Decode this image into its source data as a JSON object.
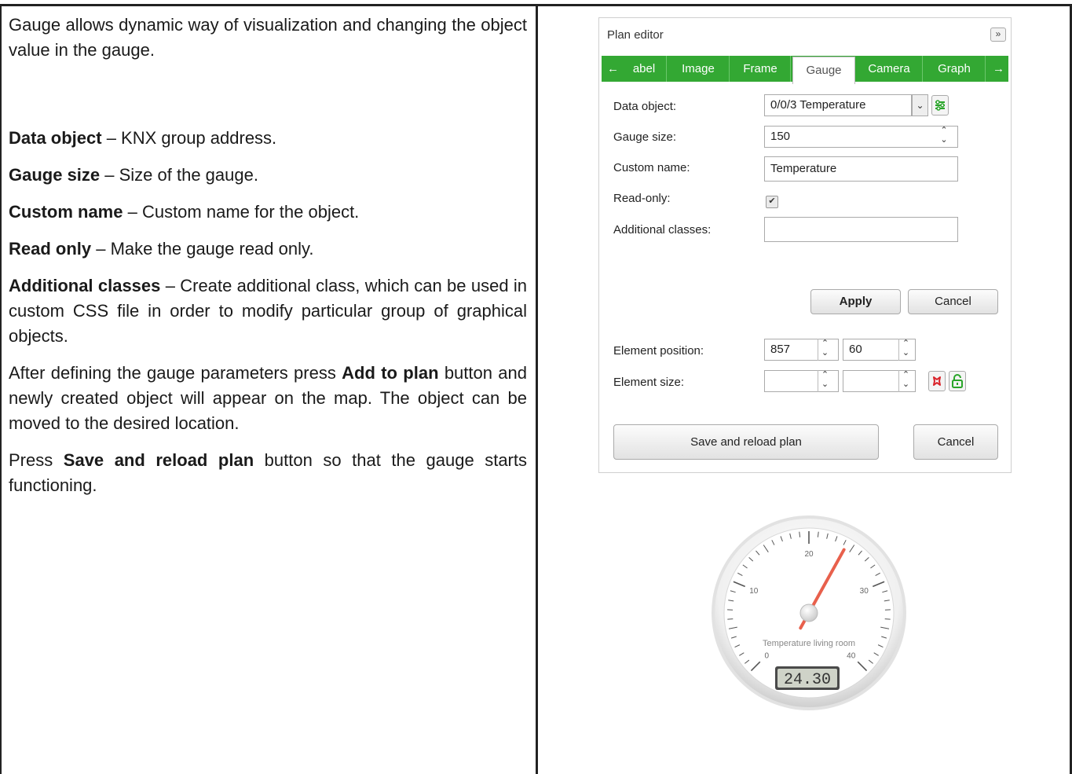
{
  "text": {
    "intro": "Gauge allows dynamic way of visualization and changing the object value in the gauge.",
    "items": [
      {
        "term": "Data object",
        "desc": " – KNX group address."
      },
      {
        "term": "Gauge size",
        "desc": " – Size of the gauge."
      },
      {
        "term": "Custom name",
        "desc": " – Custom name for the object."
      },
      {
        "term": "Read only",
        "desc": " – Make the gauge read only."
      },
      {
        "term": "Additional classes",
        "desc": " – Create additional class, which can be used in custom CSS file in order to modify particular group of graphical objects."
      }
    ],
    "after_pre": "After defining the gauge parameters press ",
    "after_bold": "Add to plan",
    "after_post": " button and newly created object will appear on the map. The object can be moved to the desired location.",
    "press_pre": "Press ",
    "press_bold": "Save and reload plan",
    "press_post": " button so that the gauge starts functioning."
  },
  "panel": {
    "title": "Plan editor",
    "collapse": "»",
    "tabs": [
      "abel",
      "Image",
      "Frame",
      "Gauge",
      "Camera",
      "Graph"
    ],
    "active_tab": "Gauge",
    "tab_left_arrow": "←",
    "tab_right_arrow": "→",
    "labels": {
      "data_object": "Data object:",
      "gauge_size": "Gauge size:",
      "custom_name": "Custom name:",
      "read_only": "Read-only:",
      "additional_classes": "Additional classes:",
      "element_position": "Element position:",
      "element_size": "Element size:"
    },
    "values": {
      "data_object": "0/0/3 Temperature",
      "gauge_size": "150",
      "custom_name": "Temperature",
      "read_only": true,
      "additional_classes": "",
      "pos_x": "857",
      "pos_y": "60",
      "size_w": "",
      "size_h": ""
    },
    "buttons": {
      "apply": "Apply",
      "cancel": "Cancel",
      "save_reload": "Save and reload plan",
      "cancel2": "Cancel"
    }
  },
  "gauge": {
    "title": "Temperature living room",
    "value": "24.30",
    "value_num": 24.3,
    "min": 0,
    "max": 40,
    "tick_labels": [
      "0",
      "10",
      "20",
      "30",
      "40"
    ],
    "needle_color": "#e8604c"
  }
}
